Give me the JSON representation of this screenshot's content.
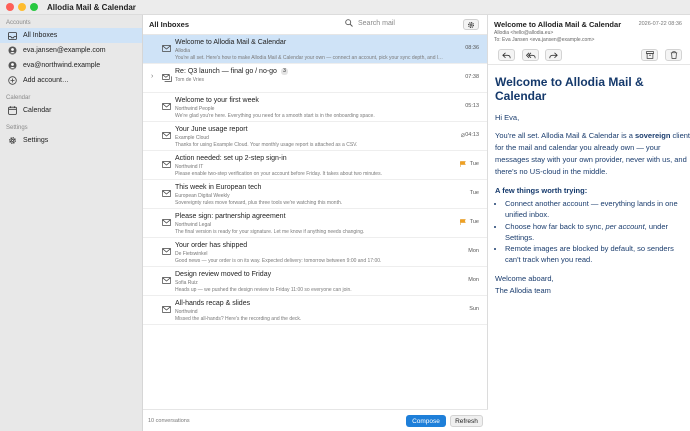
{
  "app": {
    "title": "Allodia Mail & Calendar"
  },
  "sidebar": {
    "accounts_label": "Accounts",
    "items": [
      {
        "label": "All Inboxes",
        "icon": "inbox-icon",
        "selected": true
      },
      {
        "label": "eva.jansen@example.com",
        "icon": "account-icon"
      },
      {
        "label": "eva@northwind.example",
        "icon": "account-icon"
      },
      {
        "label": "Add account…",
        "icon": "plus-icon"
      }
    ],
    "calendar_label": "Calendar",
    "calendar_item": "Calendar",
    "settings_label": "Settings",
    "settings_item": "Settings"
  },
  "list": {
    "title": "All Inboxes",
    "search_placeholder": "Search mail",
    "footer_count": "10 conversations",
    "compose_label": "Compose",
    "refresh_label": "Refresh",
    "rows": [
      {
        "subject": "Welcome to Allodia Mail & Calendar",
        "sender": "Allodia",
        "preview": "You're all set. Here's how to make Allodia Mail & Calendar your own — connect an account, pick your sync depth, and l…",
        "time": "08:36",
        "selected": true
      },
      {
        "subject": "Re: Q3 launch — final go / no-go",
        "count": "3",
        "sender": "Tom de Vries",
        "preview": "",
        "time": "07:38",
        "thread": true
      },
      {
        "subject": "Welcome to your first week",
        "sender": "Northwind People",
        "preview": "We're glad you're here. Everything you need for a smooth start is in the onboarding space.",
        "time": "05:13"
      },
      {
        "subject": "Your June usage report",
        "sender": "Example Cloud",
        "preview": "Thanks for using Example Cloud. Your monthly usage report is attached as a CSV.",
        "time": "04:13",
        "attachment": true
      },
      {
        "subject": "Action needed: set up 2-step sign-in",
        "sender": "Northwind IT",
        "preview": "Please enable two-step verification on your account before Friday. It takes about two minutes.",
        "time": "Tue",
        "flagged": true
      },
      {
        "subject": "This week in European tech",
        "sender": "European Digital Weekly",
        "preview": "Sovereignty rules move forward, plus three tools we're watching this month.",
        "time": "Tue"
      },
      {
        "subject": "Please sign: partnership agreement",
        "sender": "Northwind Legal",
        "preview": "The final version is ready for your signature. Let me know if anything needs changing.",
        "time": "Tue",
        "flagged": true
      },
      {
        "subject": "Your order has shipped",
        "sender": "De Fietswinkel",
        "preview": "Good news — your order is on its way. Expected delivery: tomorrow between 9:00 and 17:00.",
        "time": "Mon"
      },
      {
        "subject": "Design review moved to Friday",
        "sender": "Sofia Ruiz",
        "preview": "Heads up — we pushed the design review to Friday 11:00 so everyone can join.",
        "time": "Mon"
      },
      {
        "subject": "All-hands recap & slides",
        "sender": "Northwind",
        "preview": "Missed the all-hands? Here's the recording and the deck.",
        "time": "Sun"
      }
    ]
  },
  "reader": {
    "subject": "Welcome to Allodia Mail & Calendar",
    "date": "2026-07-22 08:36",
    "from": "Allodia <hello@allodia.eu>",
    "to": "To: Eva Jansen <eva.jansen@example.com>",
    "heading": "Welcome to Allodia Mail & Calendar",
    "greeting": "Hi Eva,",
    "intro_pre": "You're all set. Allodia Mail & Calendar is a ",
    "intro_bold": "sovereign",
    "intro_post": " client for the mail and calendar you already own — your messages stay with your own provider, never with us, and there's no US-cloud in the middle.",
    "tips_heading": "A few things worth trying:",
    "tip1": "Connect another account — everything lands in one unified inbox.",
    "tip2_pre": "Choose how far back to sync, ",
    "tip2_em": "per account",
    "tip2_post": ", under Settings.",
    "tip3": "Remote images are blocked by default, so senders can't track when you read.",
    "signoff1": "Welcome aboard,",
    "signoff2": "The Allodia team"
  }
}
